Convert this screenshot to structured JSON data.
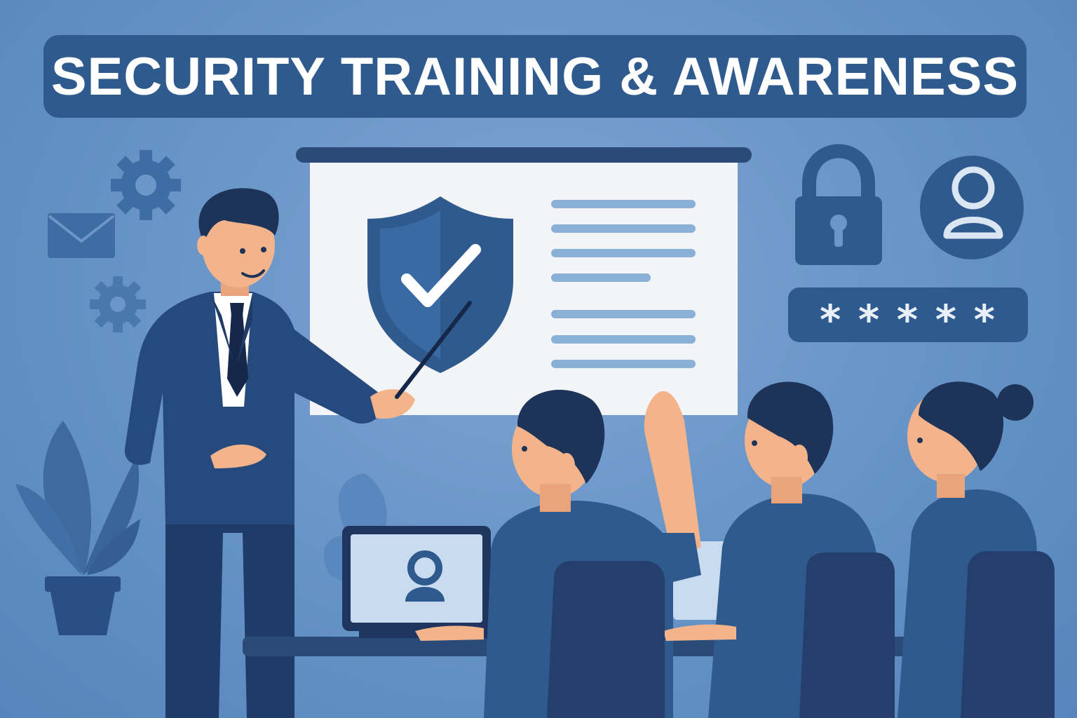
{
  "title": "SECURITY TRAINING & AWARENESS",
  "password_mask": "*****",
  "colors": {
    "background": "#6a96c8",
    "navy": "#2f5a8e",
    "dark_suit": "#22406f",
    "screen": "#f2f4f8",
    "skin": "#f3b48c",
    "hair": "#1d3357"
  },
  "icons": [
    "gear-icon",
    "envelope-icon",
    "padlock-icon",
    "user-avatar-icon",
    "shield-check-icon",
    "laptop-user-icon",
    "plant-icon"
  ]
}
